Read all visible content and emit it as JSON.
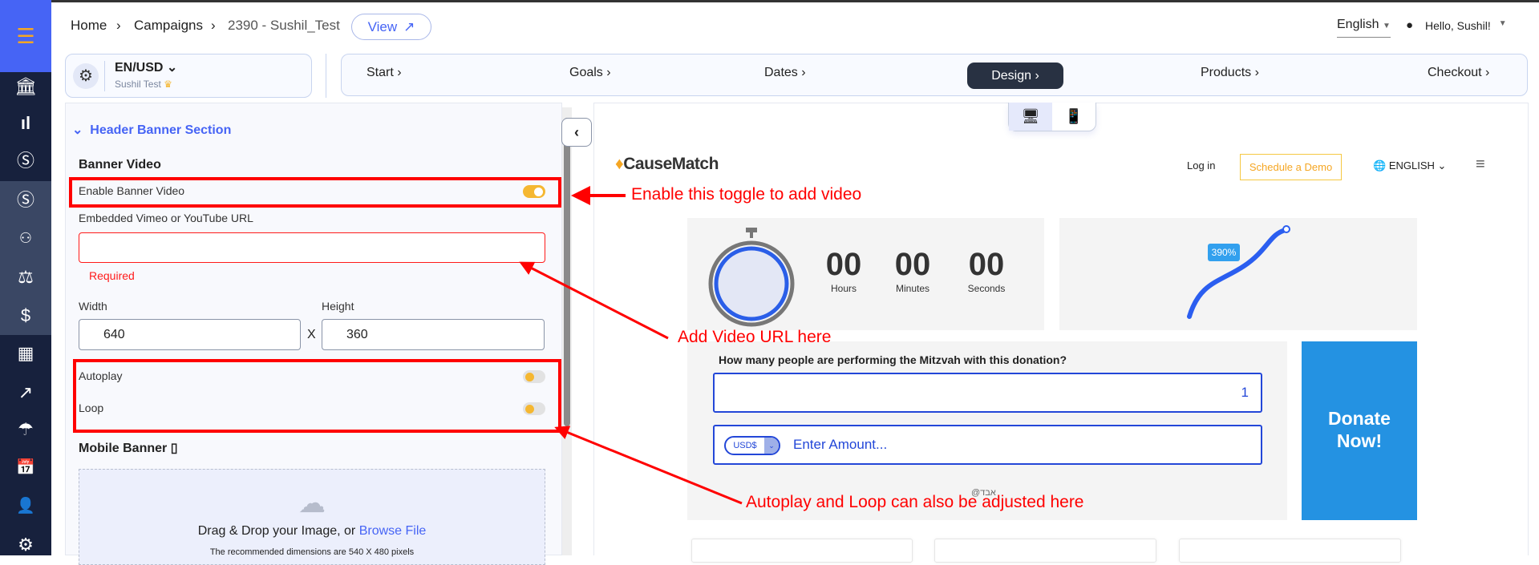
{
  "breadcrumb": {
    "home": "Home",
    "campaigns": "Campaigns",
    "current": "2390  -  Sushil_Test",
    "view_label": "View"
  },
  "header": {
    "language": "English",
    "greeting": "Hello, Sushil!"
  },
  "campaign_card": {
    "locale": "EN/USD",
    "name": "Sushil Test"
  },
  "steps": [
    {
      "label": "Start"
    },
    {
      "label": "Goals"
    },
    {
      "label": "Dates"
    },
    {
      "label": "Design",
      "active": true
    },
    {
      "label": "Products"
    },
    {
      "label": "Checkout"
    }
  ],
  "sidebar": {
    "icons": [
      "bank-icon",
      "bar-chart-icon",
      "dollar-circle-icon",
      "dollar-circle-icon",
      "users-icon",
      "scales-icon",
      "dollar-icon",
      "grid-icon",
      "arrow-up-right-icon",
      "umbrella-icon",
      "calendar-check-icon",
      "user-icon",
      "gear-icon"
    ]
  },
  "panel": {
    "section_title": "Header Banner Section",
    "banner_video_heading": "Banner Video",
    "enable_banner_video": {
      "label": "Enable Banner Video",
      "on": true
    },
    "url_label": "Embedded Vimeo or YouTube URL",
    "url_value": "",
    "url_error": "Required",
    "width_label": "Width",
    "width_value": "640",
    "height_label": "Height",
    "height_value": "360",
    "times": "X",
    "autoplay": {
      "label": "Autoplay",
      "on": false
    },
    "loop": {
      "label": "Loop",
      "on": false
    },
    "mobile_banner_heading": "Mobile Banner",
    "dropzone_text": "Drag & Drop your Image, or ",
    "browse_label": "Browse File",
    "dropzone_hint": "The recommended dimensions are 540 X 480 pixels"
  },
  "preview": {
    "logo": "CauseMatch",
    "login": "Log in",
    "schedule_demo": "Schedule a Demo",
    "language": "ENGLISH",
    "countdown": [
      {
        "value": "00",
        "unit": "Hours"
      },
      {
        "value": "00",
        "unit": "Minutes"
      },
      {
        "value": "00",
        "unit": "Seconds"
      }
    ],
    "progress_badge": "390%",
    "question": "How many people are performing the Mitzvah with this donation?",
    "people_value": "1",
    "currency": "USD$",
    "amount_placeholder": "Enter Amount...",
    "donate_line1": "Donate",
    "donate_line2": "Now!",
    "watermark": "@אבד"
  },
  "annotations": {
    "toggle": "Enable this toggle to add video",
    "url": "Add Video URL here",
    "autoplay": "Autoplay and Loop can also be adjusted here"
  },
  "colors": {
    "accent": "#4664f5",
    "sidebar": "#17213d",
    "toggle": "#f5b731",
    "annotation": "#ff0000",
    "donate": "#2492e2"
  }
}
